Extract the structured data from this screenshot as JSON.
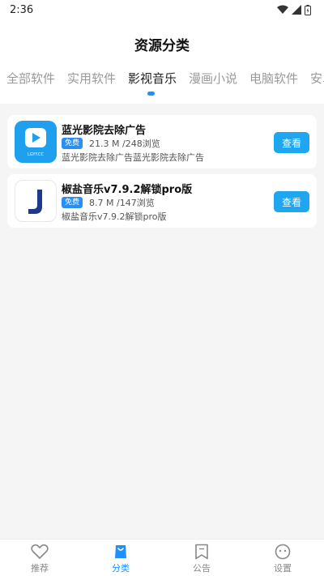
{
  "status": {
    "time": "2:36"
  },
  "page_title": "资源分类",
  "tabs": [
    {
      "label": "全部软件",
      "active": false
    },
    {
      "label": "实用软件",
      "active": false
    },
    {
      "label": "影视音乐",
      "active": true
    },
    {
      "label": "漫画小说",
      "active": false
    },
    {
      "label": "电脑软件",
      "active": false
    },
    {
      "label": "安卓",
      "active": false
    }
  ],
  "items": [
    {
      "icon": "lgyy-play-icon",
      "icon_text": "LGYY.CC",
      "name": "蓝光影院去除广告",
      "badge": "免费",
      "meta": "21.3 M /248浏览",
      "desc": "蓝光影院去除广告蓝光影院去除广告",
      "button": "查看"
    },
    {
      "icon": "jiaoyan-j-icon",
      "name": "椒盐音乐v7.9.2解锁pro版",
      "badge": "免费",
      "meta": "8.7 M /147浏览",
      "desc": "椒盐音乐v7.9.2解锁pro版",
      "button": "查看"
    }
  ],
  "nav": [
    {
      "label": "推荐",
      "icon": "heart-icon",
      "active": false
    },
    {
      "label": "分类",
      "icon": "bag-icon",
      "active": true
    },
    {
      "label": "公告",
      "icon": "bookmark-icon",
      "active": false
    },
    {
      "label": "设置",
      "icon": "smile-icon",
      "active": false
    }
  ],
  "colors": {
    "accent": "#1e90ff",
    "button": "#1ea7f0",
    "badge": "#2a8ff5"
  }
}
